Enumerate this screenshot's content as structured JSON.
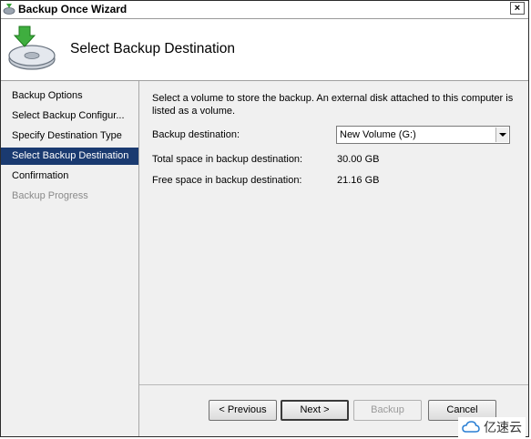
{
  "window": {
    "title": "Backup Once Wizard",
    "close_glyph": "×"
  },
  "header": {
    "title": "Select Backup Destination",
    "icon": "backup-disk-icon"
  },
  "nav": {
    "items": [
      {
        "label": "Backup Options",
        "state": "normal"
      },
      {
        "label": "Select Backup Configur...",
        "state": "normal"
      },
      {
        "label": "Specify Destination Type",
        "state": "normal"
      },
      {
        "label": "Select Backup Destination",
        "state": "active"
      },
      {
        "label": "Confirmation",
        "state": "normal"
      },
      {
        "label": "Backup Progress",
        "state": "disabled"
      }
    ]
  },
  "content": {
    "description": "Select a volume to store the backup. An external disk attached to this computer is listed as a volume.",
    "destination_label": "Backup destination:",
    "destination_value": "New Volume (G:)",
    "total_label": "Total space in backup destination:",
    "total_value": "30.00 GB",
    "free_label": "Free space in backup destination:",
    "free_value": "21.16 GB"
  },
  "buttons": {
    "previous": "< Previous",
    "next": "Next >",
    "backup": "Backup",
    "cancel": "Cancel"
  },
  "watermark": {
    "text": "亿速云"
  },
  "colors": {
    "active_nav": "#1a3a70",
    "window_bg": "#f0f0f0"
  }
}
